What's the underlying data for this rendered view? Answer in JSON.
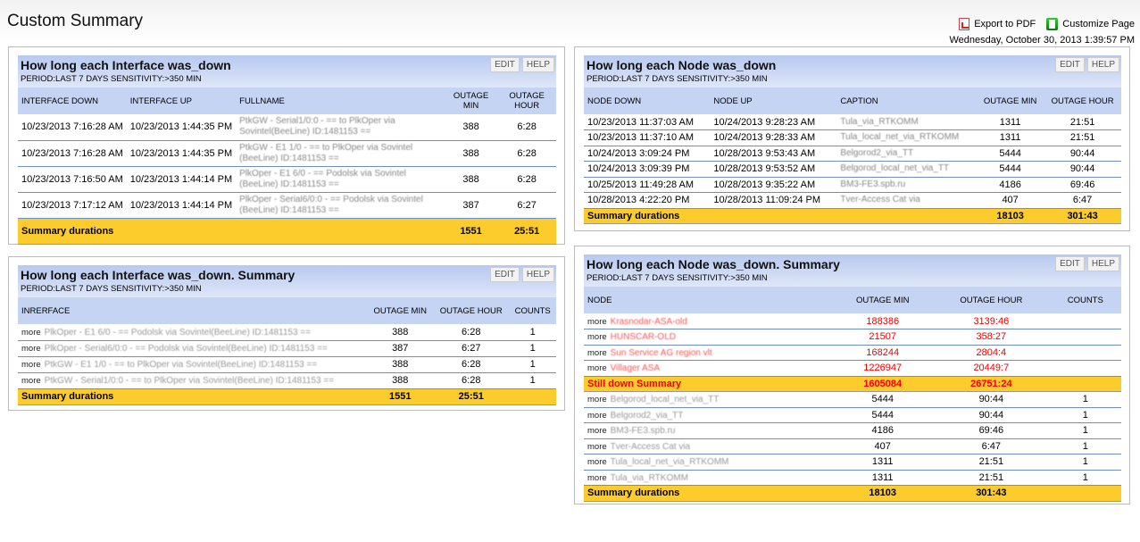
{
  "page": {
    "title": "Custom Summary",
    "export_pdf": "Export to PDF",
    "customize": "Customize Page",
    "date": "Wednesday, October 30, 2013 1:39:57 PM"
  },
  "panels": [
    {
      "id": "p1",
      "title": "How long each Interface was_down",
      "subtitle": "PERIOD:LAST 7 DAYS SENSITIVITY:>350 MIN",
      "edit": "EDIT",
      "help": "HELP",
      "columns": [
        "INTERFACE DOWN",
        "INTERFACE UP",
        "FULLNAME",
        "OUTAGE MIN",
        "OUTAGE HOUR"
      ],
      "rows": [
        [
          "10/23/2013 7:16:28 AM",
          "10/23/2013 1:44:35 PM",
          "PtkGW - Serial1/0:0 - == to PlkOper via Sovintel(BeeLine) ID:1481153 ==",
          "388",
          "6:28"
        ],
        [
          "10/23/2013 7:16:28 AM",
          "10/23/2013 1:44:35 PM",
          "PtkGW - E1 1/0 - == to PlkOper via Sovintel (BeeLine) ID:1481153 ==",
          "388",
          "6:28"
        ],
        [
          "10/23/2013 7:16:50 AM",
          "10/23/2013 1:44:14 PM",
          "PlkOper - E1 6/0 - == Podolsk via Sovintel (BeeLine) ID:1481153 ==",
          "388",
          "6:28"
        ],
        [
          "10/23/2013 7:17:12 AM",
          "10/23/2013 1:44:14 PM",
          "PlkOper - Serial6/0:0 - == Podolsk via Sovintel (BeeLine) ID:1481153 ==",
          "387",
          "6:27"
        ]
      ],
      "summary": {
        "label": "Summary durations",
        "min": "1551",
        "hour": "25:51"
      }
    },
    {
      "id": "p2",
      "title": "How long each Interface was_down. Summary",
      "subtitle": "PERIOD:LAST 7 DAYS SENSITIVITY:>350 MIN",
      "edit": "EDIT",
      "help": "HELP",
      "columns": [
        "INRERFACE",
        "OUTAGE MIN",
        "OUTAGE HOUR",
        "COUNTS"
      ],
      "more": "more",
      "rows": [
        [
          "PlkOper - E1 6/0 - == Podolsk via Sovintel(BeeLine) ID:1481153 ==",
          "388",
          "6:28",
          "1"
        ],
        [
          "PlkOper - Serial6/0:0 - == Podolsk via Sovintel(BeeLine) ID:1481153 ==",
          "387",
          "6:27",
          "1"
        ],
        [
          "PtkGW - E1 1/0 - == to PlkOper via Sovintel(BeeLine) ID:1481153 ==",
          "388",
          "6:28",
          "1"
        ],
        [
          "PtkGW - Serial1/0:0 - == to PlkOper via Sovintel(BeeLine) ID:1481153 ==",
          "388",
          "6:28",
          "1"
        ]
      ],
      "summary": {
        "label": "Summary durations",
        "min": "1551",
        "hour": "25:51"
      }
    },
    {
      "id": "p3",
      "title": "How long each Node was_down",
      "subtitle": "PERIOD:LAST 7 DAYS SENSITIVITY:>350 MIN",
      "edit": "EDIT",
      "help": "HELP",
      "columns": [
        "NODE DOWN",
        "NODE UP",
        "CAPTION",
        "OUTAGE MIN",
        "OUTAGE HOUR"
      ],
      "rows": [
        [
          "10/23/2013 11:37:03 AM",
          "10/24/2013 9:28:23 AM",
          "Tula_via_RTKOMM",
          "1311",
          "21:51"
        ],
        [
          "10/23/2013 11:37:10 AM",
          "10/24/2013 9:28:33 AM",
          "Tula_local_net_via_RTKOMM",
          "1311",
          "21:51"
        ],
        [
          "10/24/2013 3:09:24 PM",
          "10/28/2013 9:53:43 AM",
          "Belgorod2_via_TT",
          "5444",
          "90:44"
        ],
        [
          "10/24/2013 3:09:39 PM",
          "10/28/2013 9:53:52 AM",
          "Belgorod_local_net_via_TT",
          "5444",
          "90:44"
        ],
        [
          "10/25/2013 11:49:28 AM",
          "10/28/2013 9:35:22 AM",
          "BM3-FE3.spb.ru",
          "4186",
          "69:46"
        ],
        [
          "10/28/2013 4:22:20 PM",
          "10/28/2013 11:09:24 PM",
          "Tver-Access Cat via",
          "407",
          "6:47"
        ]
      ],
      "summary": {
        "label": "Summary durations",
        "min": "18103",
        "hour": "301:43"
      }
    },
    {
      "id": "p4",
      "title": "How long each Node was_down. Summary",
      "subtitle": "PERIOD:LAST 7 DAYS SENSITIVITY:>350 MIN",
      "edit": "EDIT",
      "help": "HELP",
      "columns": [
        "NODE",
        "OUTAGE MIN",
        "OUTAGE HOUR",
        "COUNTS"
      ],
      "more": "more",
      "down_rows": [
        [
          "Krasnodar-ASA-old",
          "188386",
          "3139:46",
          ""
        ],
        [
          "HUNSCAR-OLD",
          "21507",
          "358:27",
          ""
        ],
        [
          "Sun Service AG region vlt",
          "168244",
          "2804:4",
          ""
        ],
        [
          "Villager ASA",
          "1226947",
          "20449:7",
          ""
        ]
      ],
      "down_summary": {
        "label": "Still down Summary",
        "min": "1605084",
        "hour": "26751:24"
      },
      "rows": [
        [
          "Belgorod_local_net_via_TT",
          "5444",
          "90:44",
          "1"
        ],
        [
          "Belgorod2_via_TT",
          "5444",
          "90:44",
          "1"
        ],
        [
          "BM3-FE3.spb.ru",
          "4186",
          "69:46",
          "1"
        ],
        [
          "Tver-Access Cat via",
          "407",
          "6:47",
          "1"
        ],
        [
          "Tula_local_net_via_RTKOMM",
          "1311",
          "21:51",
          "1"
        ],
        [
          "Tula_via_RTKOMM",
          "1311",
          "21:51",
          "1"
        ]
      ],
      "summary": {
        "label": "Summary durations",
        "min": "18103",
        "hour": "301:43"
      }
    }
  ],
  "colors": {
    "summary_bar": "#fccc2c",
    "header": "#c5d4f2",
    "still_down": "#e00000"
  }
}
